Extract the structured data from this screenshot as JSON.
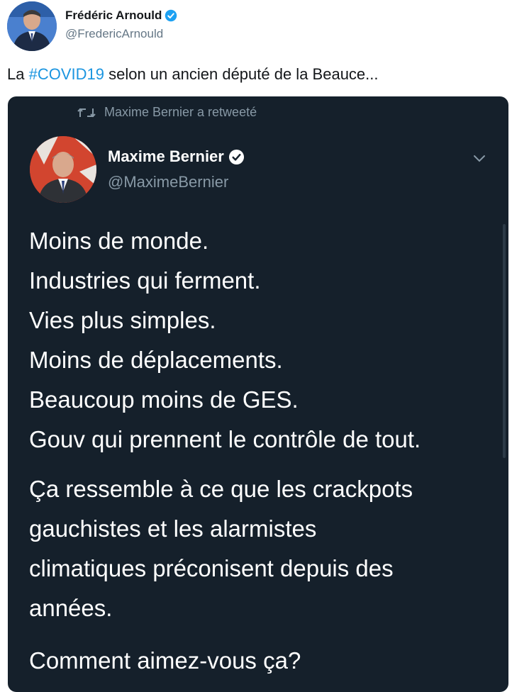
{
  "outer_tweet": {
    "author_name": "Frédéric Arnould",
    "author_handle": "@FredericArnould",
    "text_prefix": "La ",
    "hashtag": "#COVID19",
    "text_suffix": " selon un ancien député de la Beauce..."
  },
  "retweet": {
    "retweeted_by": "Maxime Bernier a retweeté",
    "author_name": "Maxime Bernier",
    "author_handle": "@MaximeBernier",
    "lines_p1": [
      "Moins de monde.",
      "Industries qui ferment.",
      "Vies plus simples.",
      "Moins de déplacements.",
      "Beaucoup moins de GES.",
      "Gouv qui prennent le contrôle de tout."
    ],
    "lines_p2": [
      "Ça ressemble à ce que les crackpots",
      "gauchistes et les alarmistes",
      "climatiques préconisent depuis des",
      "années."
    ],
    "line_p3": "Comment aimez-vous ça?"
  },
  "icons": {
    "verified": "verified-badge-icon",
    "retweet": "retweet-icon",
    "chevron": "chevron-down-icon"
  },
  "colors": {
    "hashtag": "#1b95e0",
    "embed_bg": "#15202b",
    "muted": "#8899a6",
    "verified": "#1da1f2"
  }
}
